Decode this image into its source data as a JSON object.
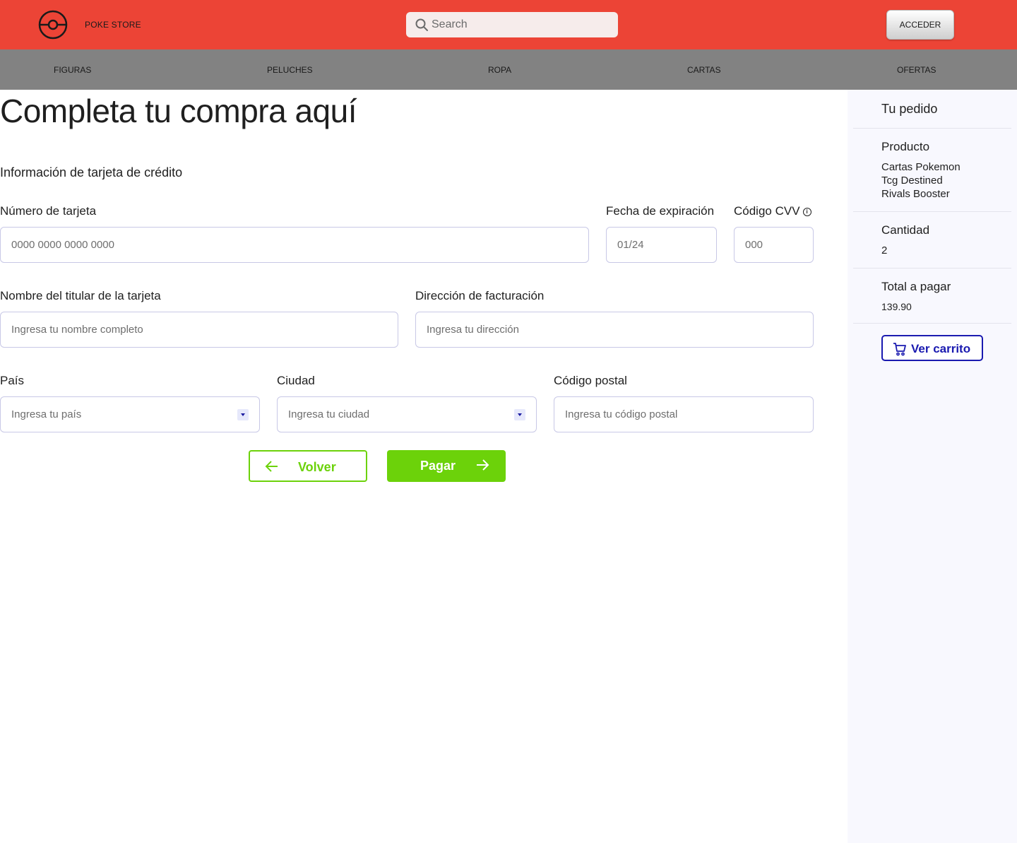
{
  "header": {
    "brand": "POKE STORE",
    "search_placeholder": "Search",
    "login_label": "ACCEDER"
  },
  "nav": {
    "items": [
      "FIGURAS",
      "PELUCHES",
      "ROPA",
      "CARTAS",
      "OFERTAS"
    ]
  },
  "main": {
    "title": "Completa tu compra aquí",
    "section_title": "Información de tarjeta de crédito",
    "card_number": {
      "label": "Número de tarjeta",
      "placeholder": "0000 0000 0000 0000"
    },
    "expiry": {
      "label": "Fecha de expiración",
      "placeholder": "01/24"
    },
    "cvv": {
      "label": "Código CVV",
      "placeholder": "000",
      "info_icon": "info-icon"
    },
    "holder": {
      "label": "Nombre del titular de la tarjeta",
      "placeholder": "Ingresa tu nombre completo"
    },
    "billing": {
      "label": "Dirección de facturación",
      "placeholder": "Ingresa tu dirección"
    },
    "country": {
      "label": "País",
      "placeholder": "Ingresa tu país"
    },
    "city": {
      "label": "Ciudad",
      "placeholder": "Ingresa tu ciudad"
    },
    "postal": {
      "label": "Código postal",
      "placeholder": "Ingresa tu código postal"
    },
    "back_label": "Volver",
    "pay_label": "Pagar"
  },
  "order": {
    "title": "Tu pedido",
    "product_label": "Producto",
    "product_lines": [
      "Cartas Pokemon",
      "Tcg Destined",
      "Rivals Booster"
    ],
    "quantity_label": "Cantidad",
    "quantity": "2",
    "total_label": "Total a pagar",
    "total": "139.90",
    "cart_label": "Ver carrito"
  },
  "colors": {
    "header_bg": "#ec4436",
    "nav_bg": "#828282",
    "accent_green": "#6cd20a",
    "accent_blue": "#1a1ab0",
    "sidebar_bg": "#f8f8fe"
  }
}
